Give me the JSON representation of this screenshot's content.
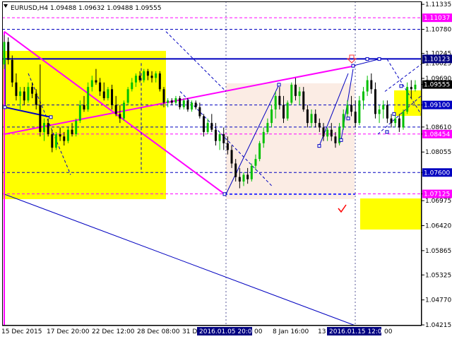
{
  "colors": {
    "background": "#ffffff",
    "frame": "#000000",
    "bull": "#00c000",
    "bear": "#000000",
    "magenta": "#ff00ff",
    "navy": "#0000c0",
    "yellow": "#ffff00",
    "pink": "#fbece4",
    "checkmark": "#ff0000",
    "label_box": "#000080"
  },
  "chart_data": {
    "type": "candlestick",
    "title": "EURUSD,H4  1.09488 1.09632 1.09488 1.09555",
    "symbol": "EURUSD,H4",
    "ohlc": [
      1.09488,
      1.09632,
      1.09488,
      1.09555
    ],
    "ylim": [
      1.042,
      1.114
    ],
    "y_ticks": [
      "1.11335",
      "1.10780",
      "1.10245",
      "1.10025",
      "1.09690",
      "1.09555",
      "1.09100",
      "1.08610",
      "1.08454",
      "1.08055",
      "1.07600",
      "1.07125",
      "1.06975",
      "1.06420",
      "1.05865",
      "1.05325",
      "1.04770",
      "1.04215"
    ],
    "x_ticks": [
      "15 Dec 2015",
      "17 Dec 20:00",
      "22 Dec 12:00",
      "28 Dec 08:00",
      "31 De",
      "2016.01.05 20:00",
      "00",
      "8 Jan 16:00",
      "13",
      "2016.01.15 12:00",
      "00"
    ],
    "price_labels": [
      {
        "value": 1.11037,
        "text": "1.11037",
        "color": "#ff00ff"
      },
      {
        "value": 1.10123,
        "text": "1.10123",
        "color": "#000080"
      },
      {
        "value": 1.09555,
        "text": "1.09555",
        "color": "#000000"
      },
      {
        "value": 1.091,
        "text": "1.09100",
        "color": "#0000c0"
      },
      {
        "value": 1.08454,
        "text": "1.08454",
        "color": "#ff00ff"
      },
      {
        "value": 1.076,
        "text": "1.07600",
        "color": "#0000c0"
      },
      {
        "value": 1.07125,
        "text": "1.07125",
        "color": "#ff00ff"
      }
    ],
    "candles": [
      [
        1.1,
        1.1065,
        1.099,
        1.105
      ],
      [
        1.105,
        1.106,
        1.1,
        1.101
      ],
      [
        1.101,
        1.102,
        1.095,
        1.096
      ],
      [
        1.096,
        1.098,
        1.092,
        1.093
      ],
      [
        1.093,
        1.095,
        1.09,
        1.094
      ],
      [
        1.094,
        1.095,
        1.091,
        1.092
      ],
      [
        1.092,
        1.096,
        1.0915,
        1.095
      ],
      [
        1.095,
        1.096,
        1.0925,
        1.0935
      ],
      [
        1.0935,
        1.0945,
        1.09,
        1.091
      ],
      [
        1.091,
        1.1,
        1.084,
        1.085
      ],
      [
        1.085,
        1.088,
        1.083,
        1.087
      ],
      [
        1.087,
        1.088,
        1.084,
        1.0845
      ],
      [
        1.0845,
        1.0855,
        1.0805,
        1.0815
      ],
      [
        1.0815,
        1.085,
        1.081,
        1.0845
      ],
      [
        1.0845,
        1.086,
        1.083,
        1.084
      ],
      [
        1.084,
        1.085,
        1.082,
        1.083
      ],
      [
        1.083,
        1.086,
        1.0825,
        1.0855
      ],
      [
        1.0855,
        1.087,
        1.084,
        1.0845
      ],
      [
        1.0845,
        1.088,
        1.084,
        1.0875
      ],
      [
        1.0875,
        1.092,
        1.087,
        1.091
      ],
      [
        1.091,
        1.093,
        1.0895,
        1.09
      ],
      [
        1.09,
        1.096,
        1.0895,
        1.095
      ],
      [
        1.095,
        1.0975,
        1.094,
        1.0965
      ],
      [
        1.0965,
        1.099,
        1.0955,
        1.096
      ],
      [
        1.096,
        1.097,
        1.093,
        1.094
      ],
      [
        1.094,
        1.096,
        1.092,
        1.0925
      ],
      [
        1.0925,
        1.095,
        1.092,
        1.0945
      ],
      [
        1.0945,
        1.0955,
        1.09,
        1.091
      ],
      [
        1.091,
        1.093,
        1.0885,
        1.089
      ],
      [
        1.089,
        1.091,
        1.087,
        1.088
      ],
      [
        1.088,
        1.092,
        1.0875,
        1.0915
      ],
      [
        1.0915,
        1.095,
        1.091,
        1.0945
      ],
      [
        1.0945,
        1.097,
        1.094,
        1.096
      ],
      [
        1.096,
        1.098,
        1.095,
        1.0975
      ],
      [
        1.0975,
        1.0985,
        1.096,
        1.0965
      ],
      [
        1.0965,
        1.099,
        1.096,
        1.0985
      ],
      [
        1.0985,
        1.099,
        1.0965,
        1.0975
      ],
      [
        1.0975,
        1.0985,
        1.096,
        1.097
      ],
      [
        1.097,
        1.0985,
        1.096,
        1.098
      ],
      [
        1.098,
        1.0985,
        1.094,
        1.0945
      ],
      [
        1.0945,
        1.095,
        1.0905,
        1.0915
      ],
      [
        1.0915,
        1.0925,
        1.0905,
        1.092
      ],
      [
        1.092,
        1.0925,
        1.091,
        1.0915
      ],
      [
        1.0915,
        1.093,
        1.091,
        1.0925
      ],
      [
        1.0925,
        1.093,
        1.09,
        1.0905
      ],
      [
        1.0905,
        1.0925,
        1.09,
        1.092
      ],
      [
        1.092,
        1.0925,
        1.0895,
        1.09
      ],
      [
        1.09,
        1.092,
        1.0895,
        1.0915
      ],
      [
        1.0915,
        1.092,
        1.09,
        1.0905
      ],
      [
        1.0905,
        1.0915,
        1.088,
        1.0885
      ],
      [
        1.0885,
        1.089,
        1.084,
        1.085
      ],
      [
        1.085,
        1.088,
        1.0845,
        1.087
      ],
      [
        1.087,
        1.089,
        1.085,
        1.0855
      ],
      [
        1.0855,
        1.087,
        1.082,
        1.083
      ],
      [
        1.083,
        1.085,
        1.081,
        1.0845
      ],
      [
        1.0845,
        1.086,
        1.081,
        1.0825
      ],
      [
        1.0825,
        1.084,
        1.08,
        1.081
      ],
      [
        1.081,
        1.082,
        1.077,
        1.078
      ],
      [
        1.078,
        1.079,
        1.074,
        1.075
      ],
      [
        1.075,
        1.077,
        1.0725,
        1.074
      ],
      [
        1.074,
        1.076,
        1.073,
        1.0755
      ],
      [
        1.0755,
        1.077,
        1.0735,
        1.0745
      ],
      [
        1.0745,
        1.078,
        1.074,
        1.0775
      ],
      [
        1.0775,
        1.08,
        1.0765,
        1.079
      ],
      [
        1.079,
        1.083,
        1.0785,
        1.0825
      ],
      [
        1.0825,
        1.086,
        1.0815,
        1.085
      ],
      [
        1.085,
        1.088,
        1.0845,
        1.087
      ],
      [
        1.087,
        1.091,
        1.086,
        1.09
      ],
      [
        1.09,
        1.094,
        1.088,
        1.093
      ],
      [
        1.093,
        1.095,
        1.09,
        1.091
      ],
      [
        1.091,
        1.093,
        1.087,
        1.088
      ],
      [
        1.088,
        1.092,
        1.0875,
        1.0915
      ],
      [
        1.0915,
        1.096,
        1.091,
        1.0955
      ],
      [
        1.0955,
        1.097,
        1.092,
        1.093
      ],
      [
        1.093,
        1.095,
        1.091,
        1.094
      ],
      [
        1.094,
        1.095,
        1.0895,
        1.09
      ],
      [
        1.09,
        1.091,
        1.086,
        1.087
      ],
      [
        1.087,
        1.09,
        1.086,
        1.089
      ],
      [
        1.089,
        1.09,
        1.086,
        1.087
      ],
      [
        1.087,
        1.088,
        1.085,
        1.086
      ],
      [
        1.086,
        1.087,
        1.083,
        1.084
      ],
      [
        1.084,
        1.086,
        1.083,
        1.0855
      ],
      [
        1.0855,
        1.087,
        1.083,
        1.084
      ],
      [
        1.084,
        1.085,
        1.0815,
        1.0825
      ],
      [
        1.0825,
        1.087,
        1.082,
        1.086
      ],
      [
        1.086,
        1.09,
        1.0855,
        1.089
      ],
      [
        1.089,
        1.092,
        1.088,
        1.091
      ],
      [
        1.091,
        1.093,
        1.0885,
        1.0895
      ],
      [
        1.0895,
        1.092,
        1.086,
        1.087
      ],
      [
        1.087,
        1.093,
        1.0865,
        1.092
      ],
      [
        1.092,
        1.095,
        1.09,
        1.094
      ],
      [
        1.094,
        1.0975,
        1.093,
        1.0965
      ],
      [
        1.0965,
        1.098,
        1.0935,
        1.0945
      ],
      [
        1.0945,
        1.096,
        1.088,
        1.089
      ],
      [
        1.089,
        1.091,
        1.087,
        1.09
      ],
      [
        1.09,
        1.092,
        1.088,
        1.091
      ],
      [
        1.091,
        1.092,
        1.087,
        1.088
      ],
      [
        1.088,
        1.089,
        1.086,
        1.087
      ],
      [
        1.087,
        1.089,
        1.086,
        1.088
      ],
      [
        1.088,
        1.089,
        1.085,
        1.086
      ],
      [
        1.086,
        1.09,
        1.0855,
        1.0895
      ],
      [
        1.0895,
        1.096,
        1.089,
        1.095
      ],
      [
        1.095,
        1.0965,
        1.0925,
        1.0945
      ],
      [
        1.0945,
        1.0965,
        1.094,
        1.0955
      ]
    ],
    "annotations": [
      "arrow-down",
      "checkmark"
    ]
  }
}
